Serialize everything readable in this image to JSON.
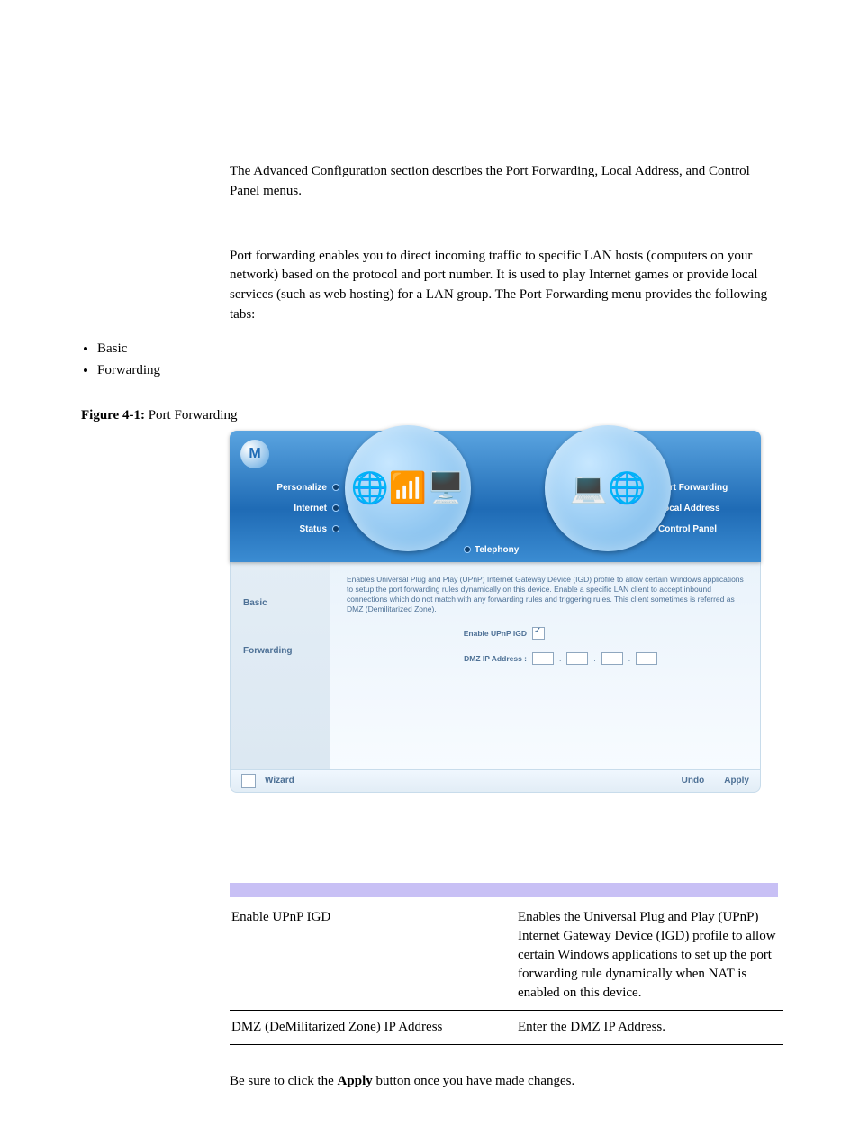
{
  "intro": {
    "p1": "The Advanced Configuration section describes the Port Forwarding, Local Address, and Control Panel menus.",
    "p2": "Port forwarding enables you to direct incoming traffic to specific LAN hosts (computers on your network) based on the protocol and port number. It is used to play Internet games or provide local services (such as web hosting) for a LAN group. The Port Forwarding menu provides the following tabs:",
    "bullets": [
      "Basic",
      "Forwarding"
    ]
  },
  "figure": {
    "label_prefix": "Figure 4-1:",
    "label": "Port Forwarding"
  },
  "router": {
    "nav_left": [
      "Personalize",
      "Internet",
      "Status"
    ],
    "nav_right": [
      "Port Forwarding",
      "Local Address",
      "Control Panel"
    ],
    "telephony": "Telephony",
    "side_tabs": [
      "Basic",
      "Forwarding"
    ],
    "desc": "Enables Universal Plug and Play (UPnP) Internet Gateway Device (IGD) profile to allow certain Windows applications to setup the port forwarding rules dynamically on this device. Enable a specific LAN client to accept inbound connections which do not match with any forwarding rules and triggering rules. This client sometimes is referred as DMZ (Demilitarized Zone).",
    "form": {
      "upnp": "Enable UPnP IGD",
      "dmz": "DMZ IP Address :"
    },
    "footer": {
      "wizard": "Wizard",
      "undo": "Undo",
      "apply": "Apply"
    }
  },
  "table": {
    "row1_field": "Enable UPnP IGD",
    "row1_desc": "Enables the Universal Plug and Play (UPnP) Internet Gateway Device (IGD) profile to allow certain Windows applications to set up the port forwarding rule dynamically when NAT is enabled on this device.",
    "row2_field": "DMZ (DeMilitarized Zone) IP Address",
    "row2_desc": "Enter the DMZ IP Address."
  },
  "closing": {
    "before": "Be sure to click the ",
    "bold": "Apply",
    "after": " button once you have made changes."
  }
}
